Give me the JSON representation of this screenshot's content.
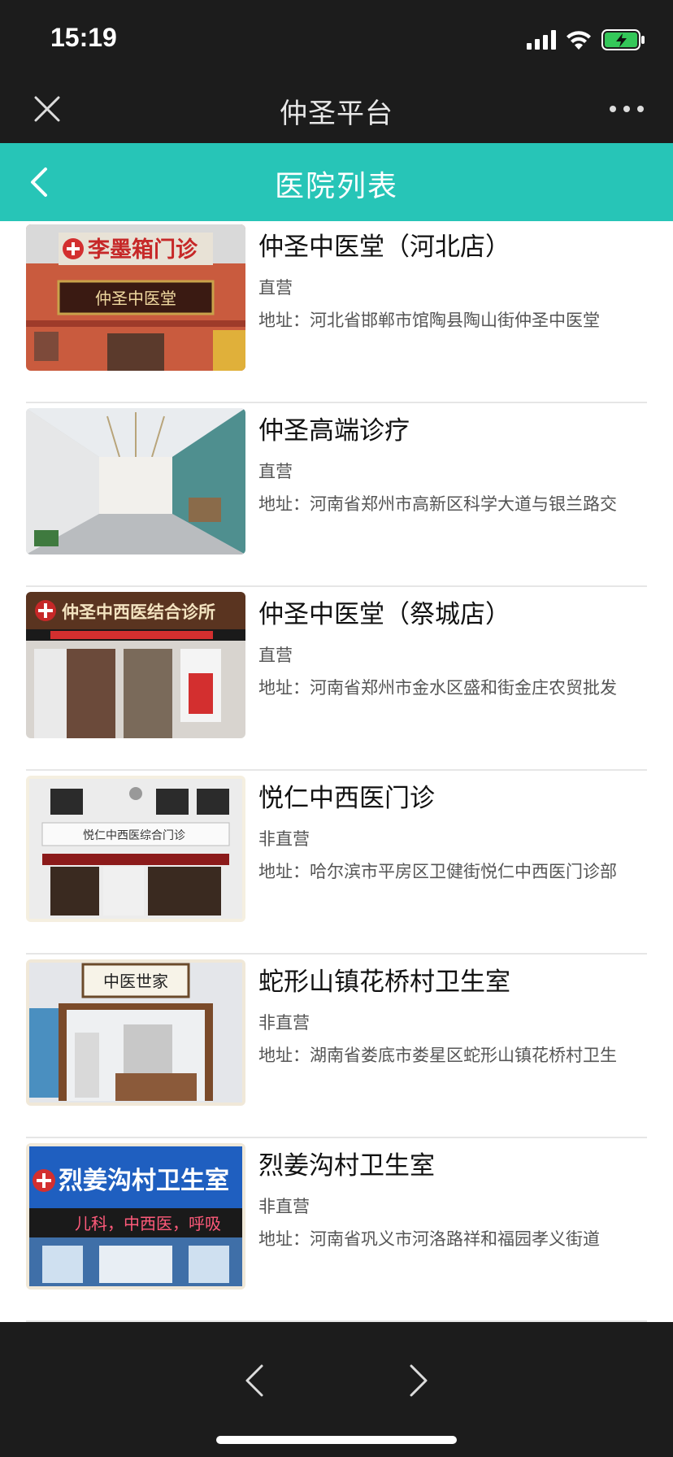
{
  "status_bar": {
    "time": "15:19",
    "battery_color": "#34c759"
  },
  "wechat_bar": {
    "title": "仲圣平台"
  },
  "header": {
    "title": "医院列表",
    "background": "#27c5b7"
  },
  "hospitals": [
    {
      "name": "仲圣中医堂（河北店）",
      "type": "直营",
      "address": "地址：河北省邯郸市馆陶县陶山街仲圣中医堂",
      "sign_text": "李墨箱门诊",
      "sub_sign": "仲圣中医堂"
    },
    {
      "name": "仲圣高端诊疗",
      "type": "直营",
      "address": "地址：河南省郑州市高新区科学大道与银兰路交"
    },
    {
      "name": "仲圣中医堂（祭城店）",
      "type": "直营",
      "address": "地址：河南省郑州市金水区盛和街金庄农贸批发",
      "sign_text": "仲圣中西医结合诊所"
    },
    {
      "name": "悦仁中西医门诊",
      "type": "非直营",
      "address": "地址：哈尔滨市平房区卫健街悦仁中西医门诊部",
      "sign_text": "悦仁中西医综合门诊"
    },
    {
      "name": "蛇形山镇花桥村卫生室",
      "type": "非直营",
      "address": "地址：湖南省娄底市娄星区蛇形山镇花桥村卫生",
      "sign_text": "中医世家"
    },
    {
      "name": "烈姜沟村卫生室",
      "type": "非直营",
      "address": "地址：河南省巩义市河洛路祥和福园孝义街道",
      "sign_text": "烈姜沟村卫生室",
      "led_text": "儿科，中西医，呼吸"
    }
  ]
}
